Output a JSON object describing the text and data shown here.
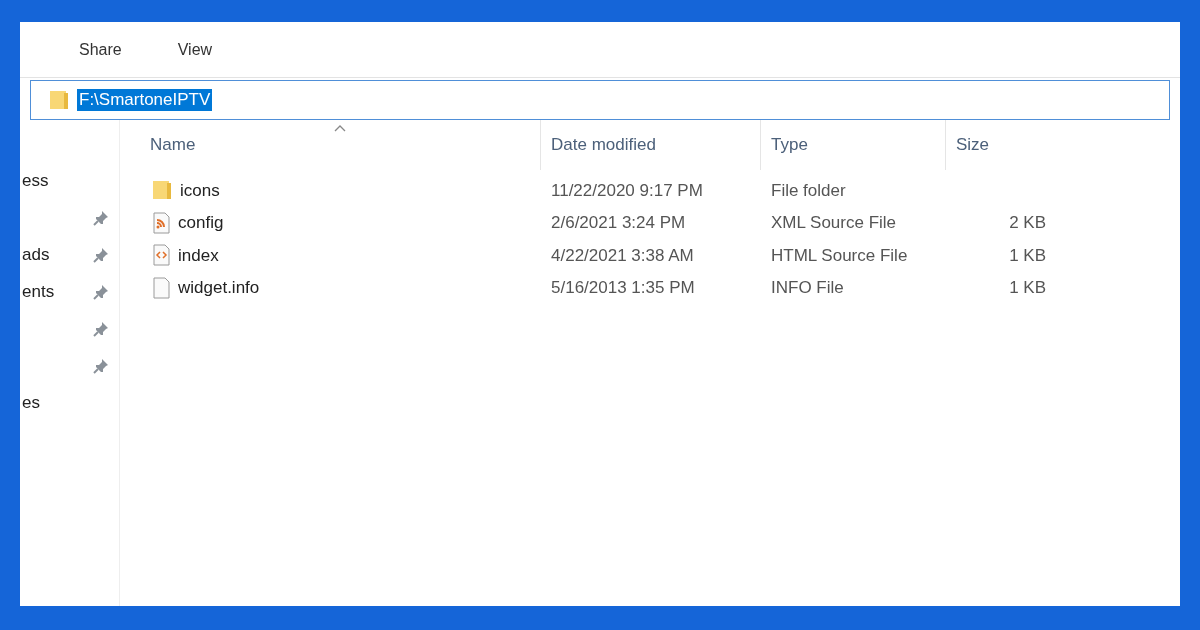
{
  "ribbon_tabs": [
    {
      "label": "Share",
      "selected": false
    },
    {
      "label": "View",
      "selected": false
    }
  ],
  "address_bar": {
    "path": "F:\\SmartoneIPTV",
    "selected": true
  },
  "sidebar": {
    "items": [
      {
        "label": "ess",
        "pinned": false
      },
      {
        "pinned": true
      },
      {
        "label": "ads",
        "pinned": true
      },
      {
        "label": "ents",
        "pinned": true
      },
      {
        "pinned": true
      },
      {
        "pinned": true
      },
      {
        "label": "es",
        "pinned": false
      }
    ]
  },
  "table": {
    "columns": [
      {
        "label": "Name",
        "sorted": true
      },
      {
        "label": "Date modified",
        "sorted": false
      },
      {
        "label": "Type",
        "sorted": false
      },
      {
        "label": "Size",
        "sorted": false
      }
    ],
    "rows": [
      {
        "kind": "folder",
        "name": "icons",
        "date": "11/22/2020 9:17 PM",
        "type": "File folder"
      },
      {
        "kind": "xml",
        "name": "config",
        "date": "2/6/2021 3:24 PM",
        "type": "XML Source File",
        "size": "2 KB"
      },
      {
        "kind": "html",
        "name": "index",
        "date": "4/22/2021 3:38 AM",
        "type": "HTML Source File",
        "size": "1 KB"
      },
      {
        "kind": "file",
        "name": "widget.info",
        "date": "5/16/2013 1:35 PM",
        "type": "INFO File",
        "size": "1 KB"
      }
    ]
  }
}
